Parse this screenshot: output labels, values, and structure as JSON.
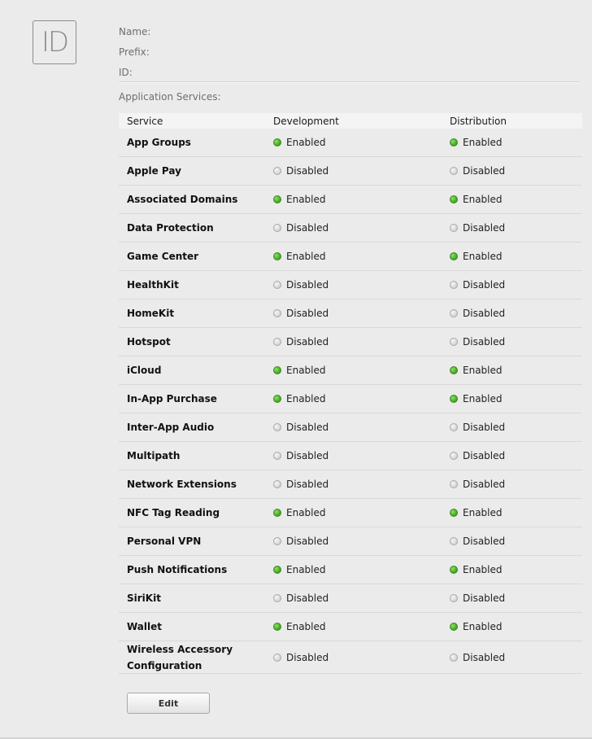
{
  "identifier": {
    "icon_text": "ID",
    "fields": [
      {
        "label": "Name:",
        "value": ""
      },
      {
        "label": "Prefix:",
        "value": ""
      },
      {
        "label": "ID:",
        "value": ""
      }
    ]
  },
  "services_section": {
    "title": "Application Services:",
    "headers": {
      "service": "Service",
      "development": "Development",
      "distribution": "Distribution"
    },
    "status_colors": {
      "enabled": "#4caf2a",
      "disabled": "#d0d0d0"
    },
    "rows": [
      {
        "name": "App Groups",
        "development": "Enabled",
        "distribution": "Enabled"
      },
      {
        "name": "Apple Pay",
        "development": "Disabled",
        "distribution": "Disabled"
      },
      {
        "name": "Associated Domains",
        "development": "Enabled",
        "distribution": "Enabled"
      },
      {
        "name": "Data Protection",
        "development": "Disabled",
        "distribution": "Disabled"
      },
      {
        "name": "Game Center",
        "development": "Enabled",
        "distribution": "Enabled"
      },
      {
        "name": "HealthKit",
        "development": "Disabled",
        "distribution": "Disabled"
      },
      {
        "name": "HomeKit",
        "development": "Disabled",
        "distribution": "Disabled"
      },
      {
        "name": "Hotspot",
        "development": "Disabled",
        "distribution": "Disabled"
      },
      {
        "name": "iCloud",
        "development": "Enabled",
        "distribution": "Enabled"
      },
      {
        "name": "In-App Purchase",
        "development": "Enabled",
        "distribution": "Enabled"
      },
      {
        "name": "Inter-App Audio",
        "development": "Disabled",
        "distribution": "Disabled"
      },
      {
        "name": "Multipath",
        "development": "Disabled",
        "distribution": "Disabled"
      },
      {
        "name": "Network Extensions",
        "development": "Disabled",
        "distribution": "Disabled"
      },
      {
        "name": "NFC Tag Reading",
        "development": "Enabled",
        "distribution": "Enabled"
      },
      {
        "name": "Personal VPN",
        "development": "Disabled",
        "distribution": "Disabled"
      },
      {
        "name": "Push Notifications",
        "development": "Enabled",
        "distribution": "Enabled"
      },
      {
        "name": "SiriKit",
        "development": "Disabled",
        "distribution": "Disabled"
      },
      {
        "name": "Wallet",
        "development": "Enabled",
        "distribution": "Enabled"
      },
      {
        "name": "Wireless Accessory Configuration",
        "development": "Disabled",
        "distribution": "Disabled"
      }
    ]
  },
  "actions": {
    "edit_label": "Edit"
  }
}
